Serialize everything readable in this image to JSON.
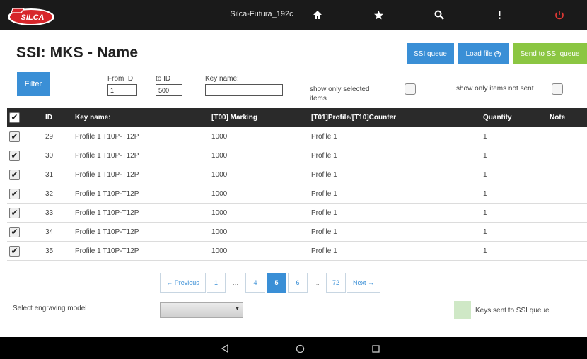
{
  "header": {
    "app_title": "Silca-Futura_192c",
    "logo_text": "SILCA",
    "icons": [
      "home-icon",
      "star-icon",
      "search-icon",
      "info-icon",
      "power-icon"
    ],
    "power_color": "#e53935"
  },
  "page": {
    "title": "SSI: MKS - Name",
    "buttons": {
      "ssi_queue": "SSI queue",
      "load_file": "Load file",
      "send_to_ssi_queue": "Send to SSI queue"
    }
  },
  "filter": {
    "button_label": "Filter",
    "from_id_label": "From ID",
    "from_id_value": "1",
    "to_id_label": "to ID",
    "to_id_value": "500",
    "key_name_label": "Key name:",
    "key_name_value": "",
    "show_selected_label": "show only selected items",
    "show_not_sent_label": "show only items not sent"
  },
  "table": {
    "columns": [
      "ID",
      "Key name:",
      "[T00] Marking",
      "[T01]Profile/[T10]Counter",
      "Quantity",
      "Note"
    ],
    "rows": [
      {
        "checked": "✔",
        "id": "29",
        "key_name": "Profile 1 T10P-T12P",
        "marking": "1000",
        "profile": "Profile 1",
        "quantity": "1",
        "note": ""
      },
      {
        "checked": "✔",
        "id": "30",
        "key_name": "Profile 1 T10P-T12P",
        "marking": "1000",
        "profile": "Profile 1",
        "quantity": "1",
        "note": ""
      },
      {
        "checked": "✔",
        "id": "31",
        "key_name": "Profile 1 T10P-T12P",
        "marking": "1000",
        "profile": "Profile 1",
        "quantity": "1",
        "note": ""
      },
      {
        "checked": "✔",
        "id": "32",
        "key_name": "Profile 1 T10P-T12P",
        "marking": "1000",
        "profile": "Profile 1",
        "quantity": "1",
        "note": ""
      },
      {
        "checked": "✔",
        "id": "33",
        "key_name": "Profile 1 T10P-T12P",
        "marking": "1000",
        "profile": "Profile 1",
        "quantity": "1",
        "note": ""
      },
      {
        "checked": "✔",
        "id": "34",
        "key_name": "Profile 1 T10P-T12P",
        "marking": "1000",
        "profile": "Profile 1",
        "quantity": "1",
        "note": ""
      },
      {
        "checked": "✔",
        "id": "35",
        "key_name": "Profile 1 T10P-T12P",
        "marking": "1000",
        "profile": "Profile 1",
        "quantity": "1",
        "note": ""
      }
    ]
  },
  "pagination": {
    "previous": "← Previous",
    "pages": [
      "1",
      "...",
      "4",
      "5",
      "6",
      "...",
      "72"
    ],
    "current": "5",
    "next": "Next →"
  },
  "footer": {
    "engraving_label": "Select engraving model",
    "engraving_value": "",
    "legend_label": "Keys sent to SSI queue",
    "legend_color": "#cfe8c6"
  },
  "navbar": {
    "icons": [
      "back-icon",
      "home-circle-icon",
      "recents-icon"
    ]
  }
}
